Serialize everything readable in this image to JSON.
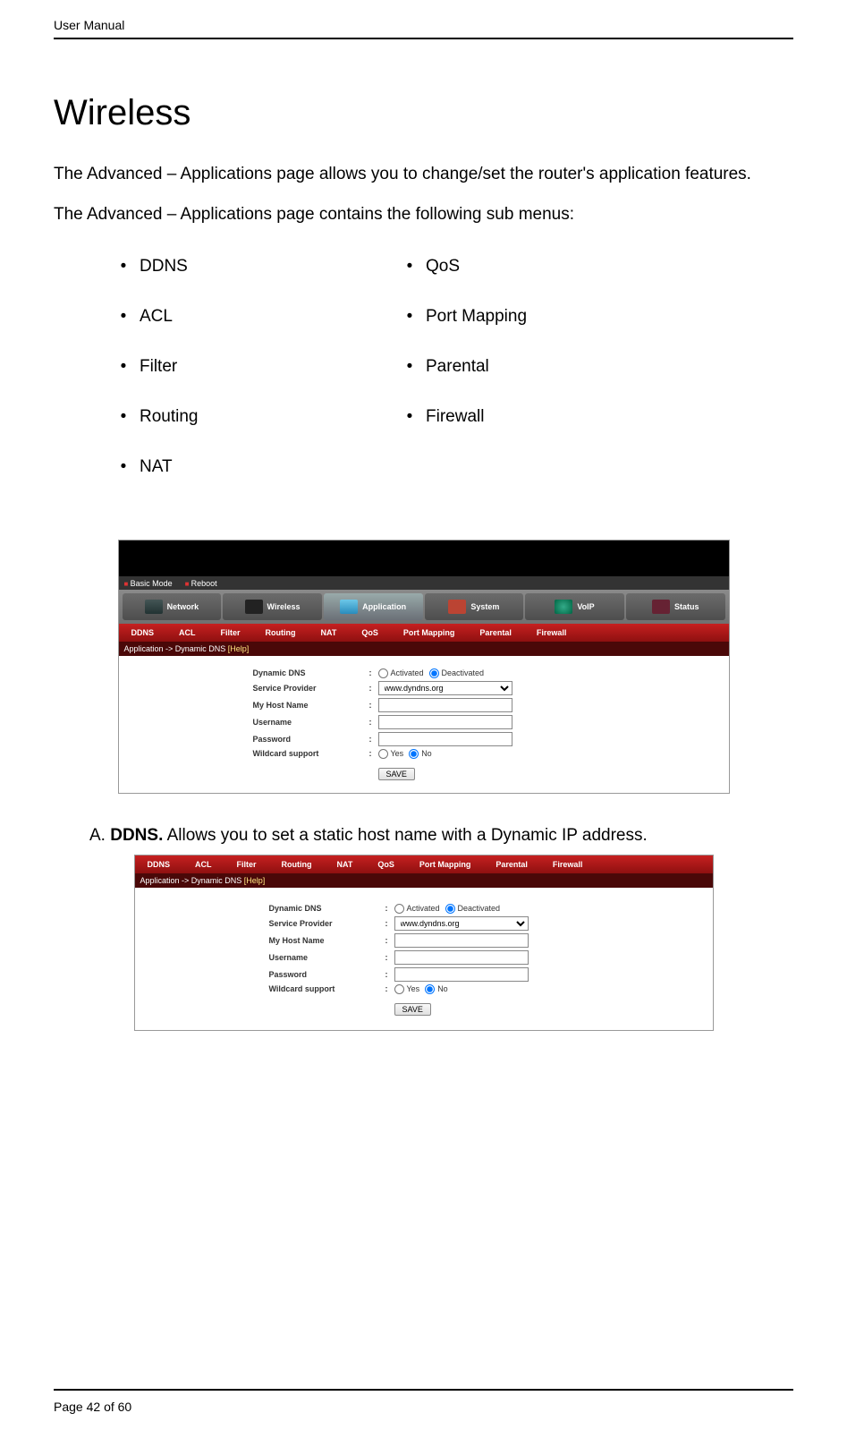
{
  "header": "User Manual",
  "title": "Wireless",
  "para1": "The Advanced – Applications page allows you to change/set the router's application features.",
  "para2": "The Advanced – Applications page contains the following sub menus:",
  "menus": {
    "c0": [
      "DDNS",
      "ACL",
      "Filter",
      "Routing",
      "NAT"
    ],
    "c1": [
      "QoS",
      "Port Mapping",
      "Parental",
      "Firewall"
    ]
  },
  "itemA": {
    "prefix": "A.",
    "bold": "DDNS.",
    "rest": " Allows you to set a static host name with a Dynamic IP address."
  },
  "footer": {
    "pg": "Page 42",
    "of": "of 60"
  },
  "router": {
    "modes": {
      "basic": "Basic Mode",
      "reboot": "Reboot"
    },
    "maintabs": [
      "Network",
      "Wireless",
      "Application",
      "System",
      "VoIP",
      "Status"
    ],
    "subtabs": [
      "DDNS",
      "ACL",
      "Filter",
      "Routing",
      "NAT",
      "QoS",
      "Port Mapping",
      "Parental",
      "Firewall"
    ],
    "crumb_prefix": "Application -> Dynamic DNS ",
    "crumb_help": "[Help]",
    "form": {
      "dyn_label": "Dynamic DNS",
      "sp_label": "Service Provider",
      "host_label": "My Host Name",
      "user_label": "Username",
      "pass_label": "Password",
      "wild_label": "Wildcard support",
      "activated": "Activated",
      "deactivated": "Deactivated",
      "sp_value": "www.dyndns.org",
      "yes": "Yes",
      "no": "No",
      "save": "SAVE"
    }
  }
}
